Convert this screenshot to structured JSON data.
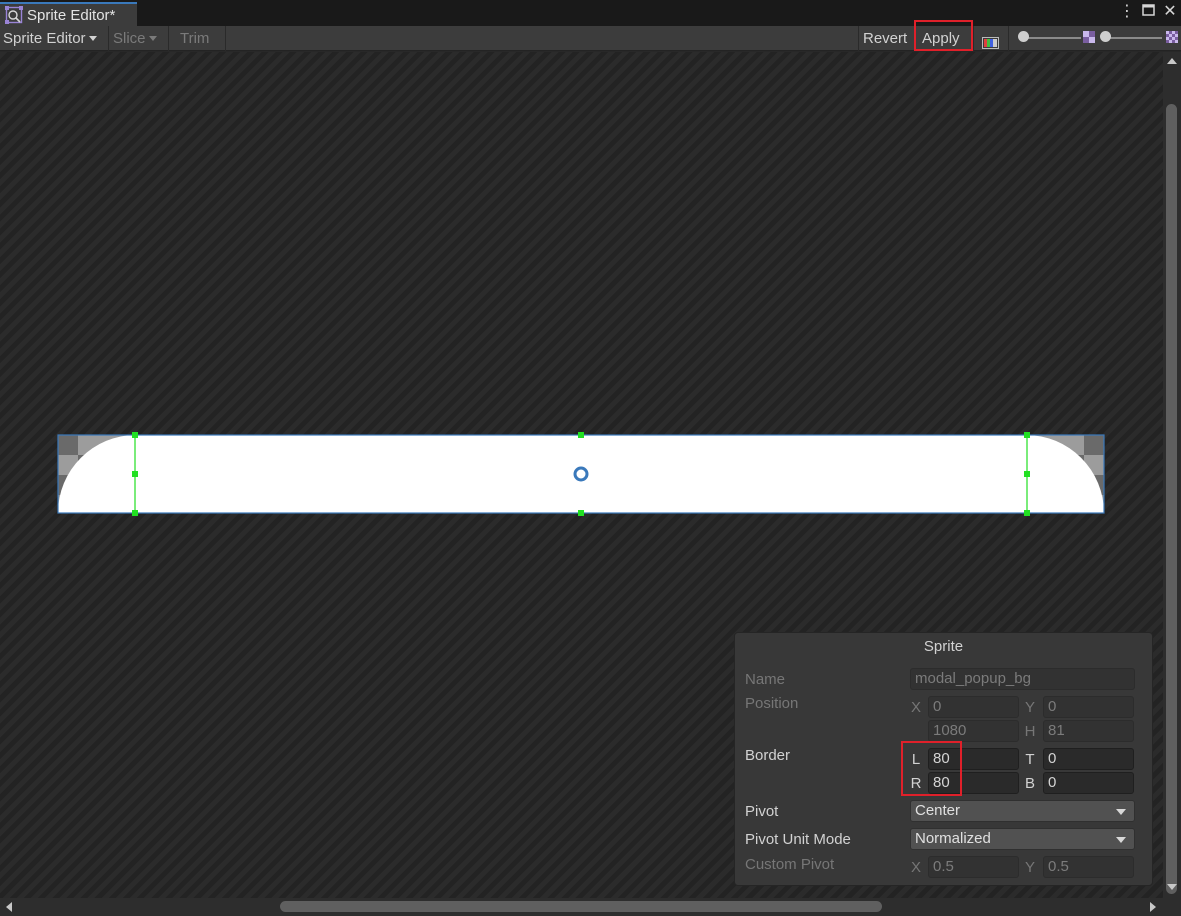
{
  "window": {
    "tab_title": "Sprite Editor*",
    "icons": [
      "sprite-editor-icon",
      "more-options-icon",
      "maximize-icon",
      "close-icon"
    ]
  },
  "toolbar": {
    "mode_dropdown": "Sprite Editor",
    "slice": "Slice",
    "trim": "Trim",
    "revert": "Revert",
    "apply": "Apply",
    "color_channel_icon": "color-channels-icon"
  },
  "sprite_panel": {
    "title": "Sprite",
    "name_label": "Name",
    "name_value": "modal_popup_bg",
    "position_label": "Position",
    "position": {
      "x_label": "X",
      "x": "0",
      "y_label": "Y",
      "y": "0",
      "w": "1080",
      "h_label": "H",
      "h": "81"
    },
    "border_label": "Border",
    "border": {
      "l_label": "L",
      "l": "80",
      "t_label": "T",
      "t": "0",
      "r_label": "R",
      "r": "80",
      "b_label": "B",
      "b": "0"
    },
    "pivot_label": "Pivot",
    "pivot_value": "Center",
    "pivot_unit_mode_label": "Pivot Unit Mode",
    "pivot_unit_mode_value": "Normalized",
    "custom_pivot_label": "Custom Pivot",
    "custom_pivot": {
      "x_label": "X",
      "x": "0.5",
      "y_label": "Y",
      "y": "0.5"
    }
  },
  "colors": {
    "highlight": "#e0202a",
    "border_guides": "#22e022",
    "sprite_outline": "#3a79bb",
    "sprite_fill": "#ffffff"
  }
}
